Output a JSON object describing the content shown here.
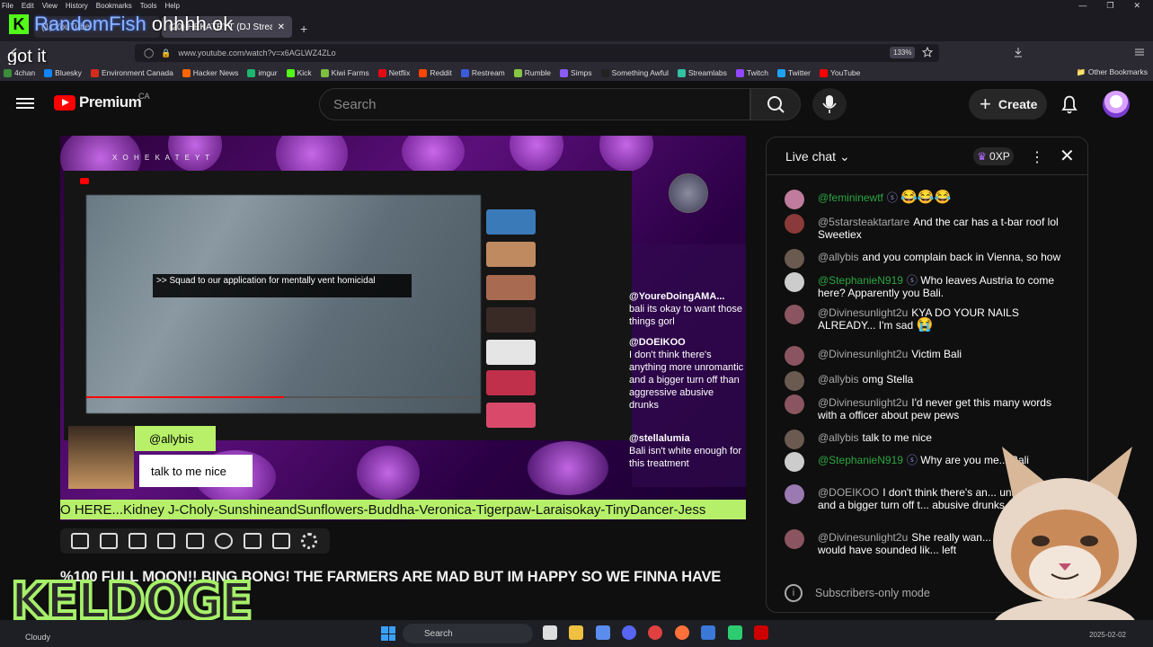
{
  "menubar": {
    "items": [
      "File",
      "Edit",
      "View",
      "History",
      "Bookmarks",
      "Tools",
      "Help"
    ]
  },
  "tabs": [
    {
      "label": "(1) YouTube"
    },
    {
      "label": "(20) HEKATEYT (DJ Stream & T"
    }
  ],
  "overlay": {
    "username": "RandomFish",
    "message": "ohhhh ok",
    "message2": "got it"
  },
  "address": {
    "url": "www.youtube.com/watch?v=x6AGLWZ4ZLo",
    "zoom": "133%"
  },
  "bookmarks": [
    {
      "label": "4chan",
      "color": "#3a8d3a"
    },
    {
      "label": "Bluesky",
      "color": "#1185fe"
    },
    {
      "label": "Environment Canada",
      "color": "#d52b1e"
    },
    {
      "label": "Hacker News",
      "color": "#ff6600"
    },
    {
      "label": "imgur",
      "color": "#1bb76e"
    },
    {
      "label": "Kick",
      "color": "#53fc18"
    },
    {
      "label": "Kiwi Farms",
      "color": "#7fbf3f"
    },
    {
      "label": "Netflix",
      "color": "#e50914"
    },
    {
      "label": "Reddit",
      "color": "#ff4500"
    },
    {
      "label": "Restream",
      "color": "#3b5bdb"
    },
    {
      "label": "Rumble",
      "color": "#85c742"
    },
    {
      "label": "Simps",
      "color": "#8a5cf6"
    },
    {
      "label": "Something Awful",
      "color": "#222222"
    },
    {
      "label": "Streamlabs",
      "color": "#31c3a2"
    },
    {
      "label": "Twitch",
      "color": "#9146ff"
    },
    {
      "label": "Twitter",
      "color": "#1da1f2"
    },
    {
      "label": "YouTube",
      "color": "#ff0000"
    }
  ],
  "other_bookmarks": "Other Bookmarks",
  "youtube": {
    "brand": "Premium",
    "region": "CA",
    "search_placeholder": "Search",
    "create_label": "Create"
  },
  "player": {
    "channel_banner": "X O H E K A T E Y T",
    "caption": ">> Squad to our application for mentally vent homicidal",
    "progress_fraction": 0.5,
    "inner_chat": [
      {
        "name": "@YoureDoingAMA...",
        "text": "bali its okay to want those things gorl"
      },
      {
        "name": "@DOEIKOO",
        "text": "I don't think there's anything more unromantic and a bigger turn off than aggressive abusive drunks"
      },
      {
        "name": "@stellalumia",
        "text": "Bali isn't white enough for this treatment"
      }
    ],
    "popup": {
      "name": "@allybis",
      "text": "talk to me nice"
    },
    "ticker": "O HERE...Kidney J-Choly-SunshineandSunflowers-Buddha-Veronica-Tigerpaw-Laraisokay-TinyDancer-Jess"
  },
  "video_title": "%100 FULL MOON!! BING BONG! THE FARMERS ARE MAD BUT IM HAPPY SO WE FINNA HAVE",
  "chat": {
    "title": "Live chat",
    "xp": "0XP",
    "messages": [
      {
        "name": "@femininewtf",
        "text": "",
        "emoji": "😂😂😂",
        "member": true,
        "color": "#c07c9c"
      },
      {
        "name": "@5starsteaktartare",
        "text": "And the car has a t-bar roof lol Sweetiex",
        "emoji": "",
        "member": false,
        "color": "#8a3a3a"
      },
      {
        "name": "@allybis",
        "text": "and you complain back in Vienna, so how",
        "emoji": "",
        "member": false,
        "color": "#6a5a50"
      },
      {
        "name": "@StephanieN919",
        "text": "Who leaves Austria to come here? Apparently you Bali.",
        "emoji": "",
        "member": true,
        "color": "#cccccc"
      },
      {
        "name": "@Divinesunlight2u",
        "text": "KYA DO YOUR NAILS ALREADY... I'm sad",
        "emoji": "😭",
        "member": false,
        "color": "#8a5560"
      },
      {
        "name": "@Divinesunlight2u",
        "text": "Victim Bali",
        "emoji": "",
        "member": false,
        "color": "#8a5560"
      },
      {
        "name": "@allybis",
        "text": "omg Stella",
        "emoji": "",
        "member": false,
        "color": "#6a5a50"
      },
      {
        "name": "@Divinesunlight2u",
        "text": "I'd never get this many words with a officer about pew pews",
        "emoji": "",
        "member": false,
        "color": "#8a5560"
      },
      {
        "name": "@allybis",
        "text": "talk to me nice",
        "emoji": "",
        "member": false,
        "color": "#6a5a50"
      },
      {
        "name": "@StephanieN919",
        "text": "Why are you me... Bali",
        "emoji": "",
        "member": true,
        "color": "#cccccc"
      },
      {
        "name": "@DOEIKOO",
        "text": "I don't think there's an... unromantic and a bigger turn off t... abusive drunks",
        "emoji": "",
        "member": false,
        "color": "#9a7ab0"
      },
      {
        "name": "@Divinesunlight2u",
        "text": "She really wan... leave ... she would have sounded lik... left",
        "emoji": "",
        "member": false,
        "color": "#8a5560"
      }
    ],
    "subscribers_mode": "Subscribers-only mode"
  },
  "overlay_brand": "KELDOGE",
  "taskbar": {
    "weather": "Cloudy",
    "search": "Search",
    "date": "2025-02-02"
  }
}
